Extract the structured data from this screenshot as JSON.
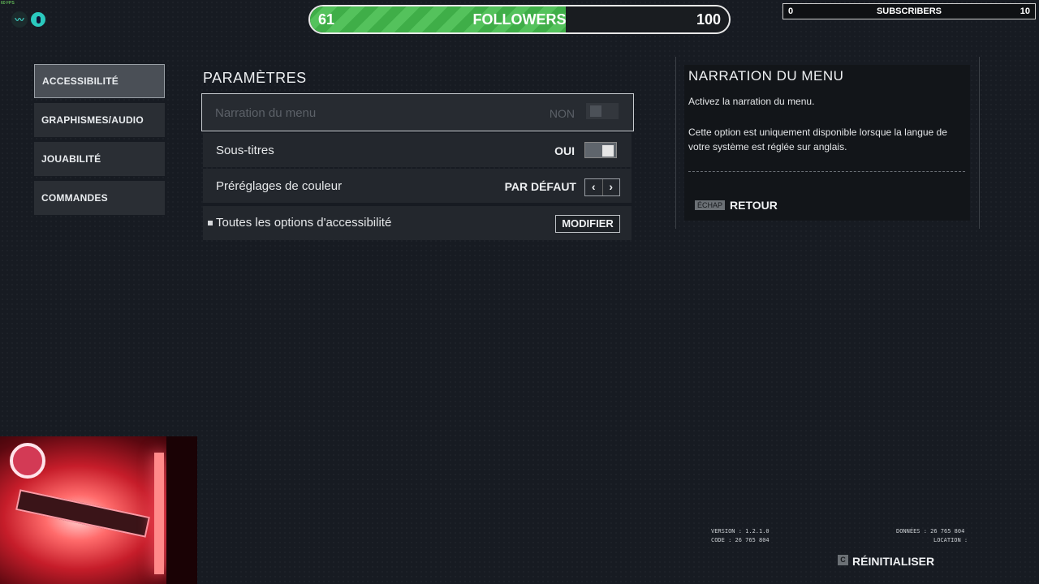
{
  "overlay": {
    "fps": "60 FPS",
    "logo_icon": "wave-logo-icon",
    "mic_icon": "microphone-icon",
    "followers": {
      "current": "61",
      "label": "FOLLOWERS",
      "goal": "100",
      "progress": 0.61,
      "color": "#4cba54"
    },
    "subscribers": {
      "current": "0",
      "label": "SUBSCRIBERS",
      "goal": "10"
    }
  },
  "nav": {
    "items": [
      {
        "label": "ACCESSIBILITÉ",
        "active": true
      },
      {
        "label": "GRAPHISMES/AUDIO",
        "active": false
      },
      {
        "label": "JOUABILITÉ",
        "active": false
      },
      {
        "label": "COMMANDES",
        "active": false
      }
    ]
  },
  "settings": {
    "title": "PARAMÈTRES",
    "rows": [
      {
        "label": "Narration du menu",
        "value": "NON",
        "control": "toggle",
        "state": "off",
        "disabled": true
      },
      {
        "label": "Sous-titres",
        "value": "OUI",
        "control": "toggle",
        "state": "on"
      },
      {
        "label": "Préréglages de couleur",
        "value": "PAR DÉFAUT",
        "control": "arrows",
        "prev": "‹",
        "next": "›"
      },
      {
        "label": "Toutes les options d'accessibilité",
        "control": "button",
        "button_label": "MODIFIER"
      }
    ]
  },
  "description": {
    "title": "NARRATION DU MENU",
    "line1": "Activez la narration du menu.",
    "line2": "Cette option est uniquement disponible lorsque la langue de votre système est réglée sur anglais.",
    "back_key": "ÉCHAP",
    "back_label": "RETOUR"
  },
  "footer": {
    "version": "VERSION : 1.2.1.0",
    "code": "CODE : 26 765 804",
    "donnees": "DONNÉES : 26 765 804",
    "location": "LOCATION :",
    "reset_key": "C",
    "reset_label": "RÉINITIALISER"
  }
}
